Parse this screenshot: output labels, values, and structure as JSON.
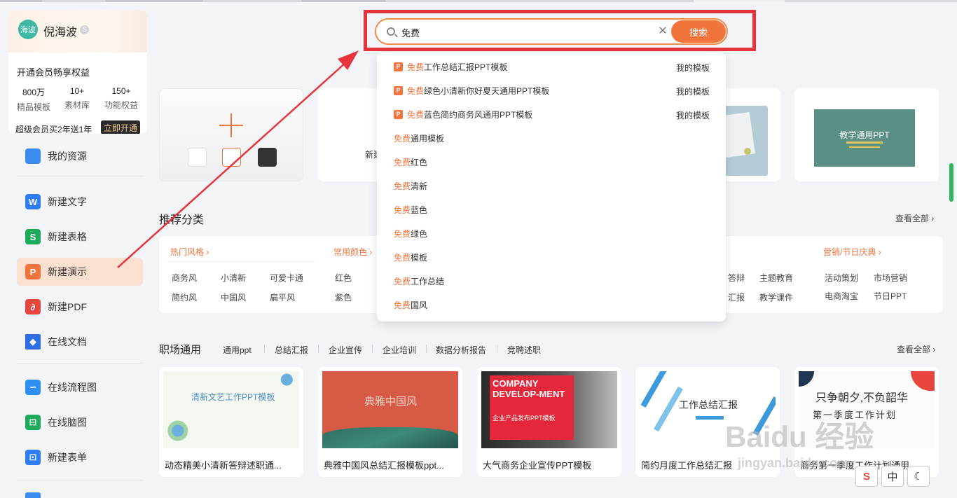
{
  "user": {
    "avatar_text": "海波",
    "name": "倪海波",
    "promo_title": "开通会员畅享权益",
    "stats": [
      {
        "value": "800万",
        "label": "精品模板"
      },
      {
        "value": "10+",
        "label": "素材库"
      },
      {
        "value": "150+",
        "label": "功能权益"
      }
    ],
    "promo_footer": "超级会员买2年送1年",
    "open_button": "立即开通"
  },
  "sidebar": {
    "items": [
      {
        "label": "我的资源",
        "icon": "folder-icon",
        "color": "#3c8cf0"
      },
      {
        "label": "新建文字",
        "icon": "writer-icon",
        "color": "#2e7cf6"
      },
      {
        "label": "新建表格",
        "icon": "spreadsheet-icon",
        "color": "#1eaa5a"
      },
      {
        "label": "新建演示",
        "icon": "presentation-icon",
        "color": "#f2743d"
      },
      {
        "label": "新建PDF",
        "icon": "pdf-icon",
        "color": "#e8453c"
      },
      {
        "label": "在线文档",
        "icon": "cloud-doc-icon",
        "color": "#2f6fe4"
      },
      {
        "label": "在线流程图",
        "icon": "flowchart-icon",
        "color": "#2e8ff0"
      },
      {
        "label": "在线脑图",
        "icon": "mindmap-icon",
        "color": "#1eaa5a"
      },
      {
        "label": "新建表单",
        "icon": "form-icon",
        "color": "#2e7cf6"
      }
    ]
  },
  "search": {
    "value": "免费",
    "button_label": "搜索",
    "suggestions": [
      {
        "highlight": "免费",
        "text": "工作总结汇报PPT模板",
        "source": "我的模板",
        "ppt": true
      },
      {
        "highlight": "免费",
        "text": "绿色小清新你好夏天通用PPT模板",
        "source": "我的模板",
        "ppt": true
      },
      {
        "highlight": "免费",
        "text": "蓝色简约商务风通用PPT模板",
        "source": "我的模板",
        "ppt": true
      },
      {
        "highlight": "免费",
        "text": "通用模板",
        "source": "",
        "ppt": false
      },
      {
        "highlight": "免费",
        "text": "红色",
        "source": "",
        "ppt": false
      },
      {
        "highlight": "免费",
        "text": "清新",
        "source": "",
        "ppt": false
      },
      {
        "highlight": "免费",
        "text": "蓝色",
        "source": "",
        "ppt": false
      },
      {
        "highlight": "免费",
        "text": "绿色",
        "source": "",
        "ppt": false
      },
      {
        "highlight": "免费",
        "text": "模板",
        "source": "",
        "ppt": false
      },
      {
        "highlight": "免费",
        "text": "工作总结",
        "source": "",
        "ppt": false
      },
      {
        "highlight": "免费",
        "text": "国风",
        "source": "",
        "ppt": false
      }
    ]
  },
  "templates_row": {
    "new_card_partial_text": "新建",
    "green_card_title": "教学通用PPT"
  },
  "recommended": {
    "title": "推荐分类",
    "see_all": "查看全部",
    "groups": [
      {
        "head": "热门风格",
        "items": [
          "商务风",
          "小清新",
          "可爱卡通",
          "简约风",
          "中国风",
          "扁平风"
        ]
      },
      {
        "head": "常用颜色",
        "items": [
          "红色",
          "紫色"
        ]
      },
      {
        "head": "",
        "items": [
          "答辩",
          "主题教育",
          "汇报",
          "教学课件"
        ]
      },
      {
        "head": "营销/节日庆典",
        "items": [
          "活动策划",
          "市场营销",
          "电商淘宝",
          "节日PPT"
        ]
      }
    ]
  },
  "workplace": {
    "title": "职场通用",
    "see_all": "查看全部",
    "tabs": [
      "通用ppt",
      "总结汇报",
      "企业宣传",
      "企业培训",
      "数据分析报告",
      "竞聘述职"
    ],
    "cards": [
      {
        "caption": "动态精美小清新答辩述职通...",
        "thumb_title": "清新文艺工作PPT模板"
      },
      {
        "caption": "典雅中国风总结汇报模板ppt...",
        "thumb_title": "典雅中国风"
      },
      {
        "caption": "大气商务企业宣传PPT模板",
        "thumb_title": "COMPANY DEVELOP-MENT",
        "thumb_sub": "企业产品发布PPT模板"
      },
      {
        "caption": "简约月度工作总结汇报",
        "thumb_title": "工作总结汇报"
      },
      {
        "caption": "商务第一季度工作计划通用",
        "thumb_title": "只争朝夕,不负韶华",
        "thumb_sub": "第一季度工作计划"
      }
    ]
  },
  "tray": {
    "items": [
      "S",
      "中",
      "☾"
    ]
  },
  "watermark": {
    "main": "Baidu 经验",
    "sub": "jingyan.baidu.com"
  }
}
